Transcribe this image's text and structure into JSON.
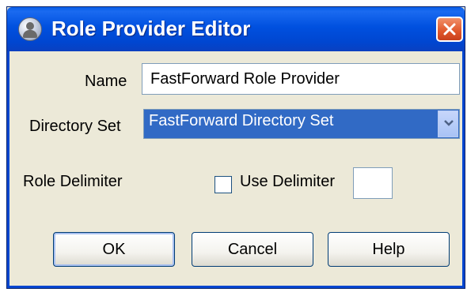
{
  "dialog": {
    "title": "Role Provider Editor",
    "icon": "role-provider-icon"
  },
  "form": {
    "name_label": "Name",
    "name_value": "FastForward Role Provider",
    "directory_set_label": "Directory Set",
    "directory_set_value": "FastForward Directory Set",
    "role_delimiter_label": "Role Delimiter",
    "use_delimiter_label": "Use Delimiter",
    "use_delimiter_checked": false,
    "delimiter_value": ""
  },
  "buttons": {
    "ok": "OK",
    "cancel": "Cancel",
    "help": "Help"
  },
  "colors": {
    "titlebar": "#0050df",
    "selection": "#316ac5",
    "close": "#e0562a"
  }
}
